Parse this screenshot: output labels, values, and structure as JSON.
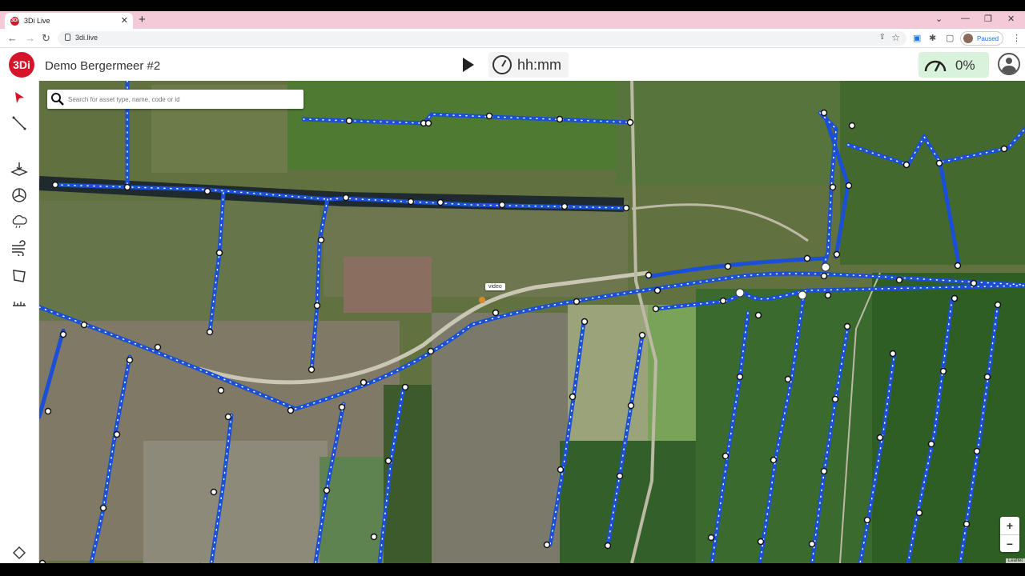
{
  "browser": {
    "tab_title": "3Di Live",
    "tab_close": "✕",
    "new_tab": "+",
    "url": "3di.live",
    "profile_status": "Paused"
  },
  "header": {
    "logo_text": "3Di",
    "project_name": "Demo Bergermeer #2",
    "time_display": "hh:mm",
    "progress": "0%"
  },
  "search": {
    "placeholder": "Search for asset type, name, code or id"
  },
  "sidebar": {
    "tools": [
      {
        "name": "select-tool",
        "icon": "pointer-arrow-icon"
      },
      {
        "name": "line-tool",
        "icon": "line-draw-icon"
      },
      {
        "name": "raster-edit-tool",
        "icon": "raster-icon"
      },
      {
        "name": "pump-tool",
        "icon": "pump-icon"
      },
      {
        "name": "rain-tool",
        "icon": "rain-cloud-icon"
      },
      {
        "name": "wind-tool",
        "icon": "wind-icon"
      },
      {
        "name": "area-tool",
        "icon": "polygon-icon"
      },
      {
        "name": "measure-tool",
        "icon": "measure-icon"
      }
    ]
  },
  "map": {
    "tooltip": "video",
    "zoom_in": "+",
    "zoom_out": "−",
    "attribution": "Leaflet",
    "channel_color": "#1a4fd6",
    "node_color": "#ffffff"
  }
}
